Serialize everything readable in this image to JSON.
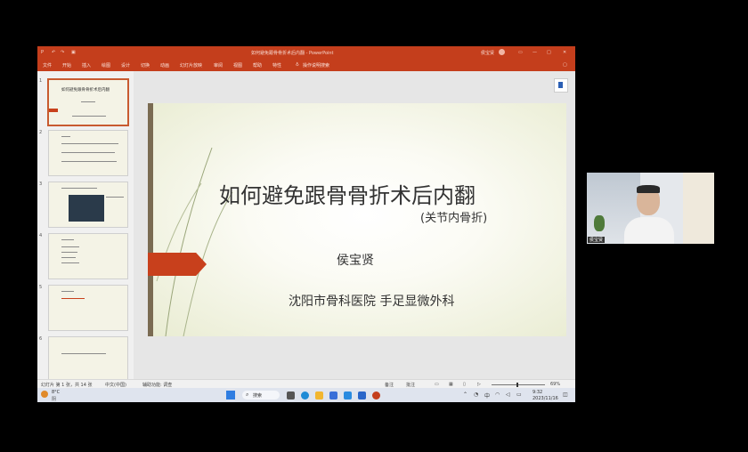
{
  "window": {
    "title": "如何避免跟骨骨折术后内翻 - PowerPoint",
    "user_name": "侯宝贤",
    "menu_tabs": [
      "文件",
      "开始",
      "插入",
      "绘图",
      "设计",
      "切换",
      "动画",
      "幻灯片放映",
      "审阅",
      "视图",
      "帮助",
      "特性"
    ],
    "search_hint": "操作说明搜索"
  },
  "thumbnails": [
    {
      "num": "1",
      "text": "如何避免跟骨骨折术后内翻"
    },
    {
      "num": "2",
      "text": ""
    },
    {
      "num": "3",
      "text": ""
    },
    {
      "num": "4",
      "text": ""
    },
    {
      "num": "5",
      "text": ""
    },
    {
      "num": "6",
      "text": ""
    }
  ],
  "slide": {
    "title": "如何避免跟骨骨折术后内翻",
    "subtitle": "(关节内骨折)",
    "author": "侯宝贤",
    "affiliation": "沈阳市骨科医院  手足显微外科"
  },
  "status": {
    "slide_info": "幻灯片 第 1 张，共 14 张",
    "language": "中文(中国)",
    "accessibility": "辅助功能: 调查",
    "notes": "备注",
    "comments": "批注",
    "zoom": "69%"
  },
  "taskbar": {
    "weather_temp": "8°C",
    "weather_desc": "阴",
    "search_label": "搜索",
    "time": "9:32",
    "date": "2023/11/16"
  },
  "webcam": {
    "name_tag": "侯宝贤"
  },
  "colors": {
    "accent": "#c43e1c",
    "slide_arrow": "#c8401c"
  }
}
